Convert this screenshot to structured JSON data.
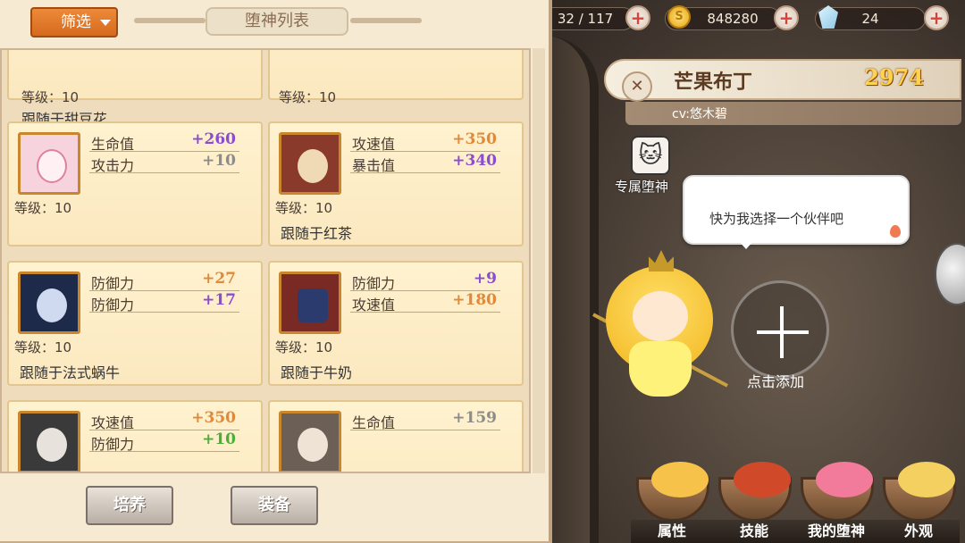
{
  "topbar": {
    "stamina": "32 / 117",
    "gold": "848280",
    "gems": "24",
    "plus_glyph": "+"
  },
  "left_panel": {
    "filter_label": "筛选",
    "title": "堕神列表",
    "cards": [
      {
        "level": "等级：10",
        "follow": "跟随于甜豆花",
        "stats": []
      },
      {
        "level": "等级：10",
        "follow": "",
        "stats": []
      },
      {
        "level": "等级：10",
        "follow": "",
        "stats": [
          {
            "k": "生命值",
            "v": "+260",
            "color": "#8a4cd0"
          },
          {
            "k": "攻击力",
            "v": "+10",
            "color": "#8c8c8c"
          }
        ]
      },
      {
        "level": "等级：10",
        "follow": "跟随于红茶",
        "stats": [
          {
            "k": "攻速值",
            "v": "+350",
            "color": "#e0893a"
          },
          {
            "k": "暴击值",
            "v": "+340",
            "color": "#8a4cd0"
          }
        ]
      },
      {
        "level": "等级：10",
        "follow": "跟随于法式蜗牛",
        "stats": [
          {
            "k": "防御力",
            "v": "+27",
            "color": "#e0893a"
          },
          {
            "k": "防御力",
            "v": "+17",
            "color": "#8a4cd0"
          }
        ]
      },
      {
        "level": "等级：10",
        "follow": "跟随于牛奶",
        "stats": [
          {
            "k": "防御力",
            "v": "+9",
            "color": "#8a4cd0"
          },
          {
            "k": "攻速值",
            "v": "+180",
            "color": "#e0893a"
          }
        ]
      },
      {
        "level": "",
        "follow": "",
        "stats": [
          {
            "k": "攻速值",
            "v": "+350",
            "color": "#e0893a"
          },
          {
            "k": "防御力",
            "v": "+10",
            "color": "#4cae3a"
          }
        ]
      },
      {
        "level": "",
        "follow": "",
        "stats": [
          {
            "k": "生命值",
            "v": "+159",
            "color": "#8c8c8c"
          }
        ]
      }
    ],
    "buttons": {
      "cultivate": "培养",
      "equip": "装备"
    }
  },
  "character": {
    "name": "芒果布丁",
    "power": "2974",
    "cv": "cv:悠木碧",
    "exclusive_label": "专属堕神",
    "speech": "快为我选择一个伙伴吧",
    "add_label": "点击添加"
  },
  "tabs": [
    {
      "label": "属性"
    },
    {
      "label": "技能"
    },
    {
      "label": "我的堕神"
    },
    {
      "label": "外观"
    }
  ],
  "colors": {
    "accent_orange": "#d56a1e",
    "panel_bg": "#f7ead2",
    "power_gold": "#ffd34a"
  },
  "icons": [
    "plus-icon",
    "coin-icon",
    "gem-icon",
    "class-icon",
    "cat-icon",
    "add-icon",
    "flame-icon",
    "dropdown-arrow-icon"
  ]
}
